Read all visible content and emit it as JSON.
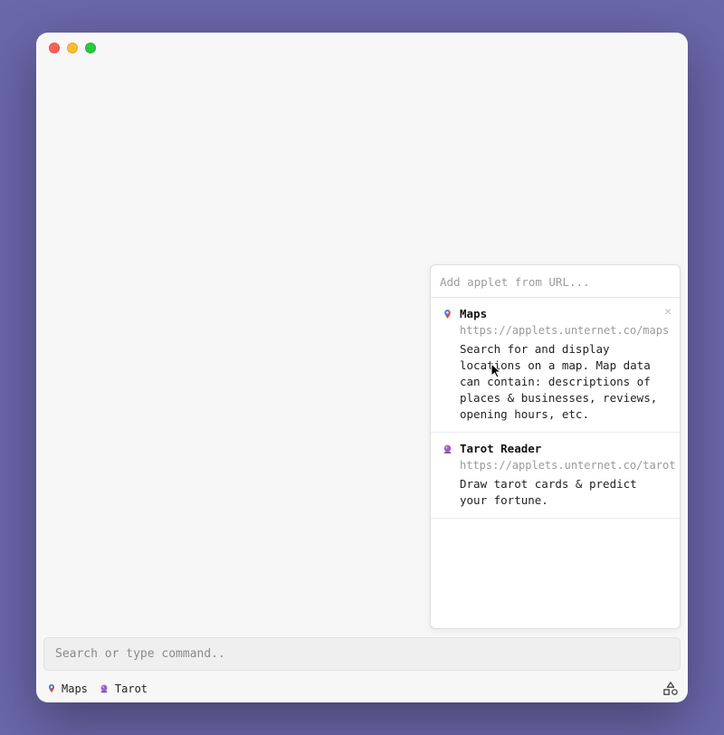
{
  "window": {
    "traffic": [
      "close",
      "minimize",
      "zoom"
    ]
  },
  "popover": {
    "url_input_placeholder": "Add applet from URL...",
    "applets": [
      {
        "icon": "maps-pin-icon",
        "name": "Maps",
        "url": "https://applets.unternet.co/maps",
        "description": "Search for and display locations on a map. Map data can contain: descriptions of places & businesses, reviews, opening hours, etc.",
        "closeable": true
      },
      {
        "icon": "crystal-ball-icon",
        "name": "Tarot Reader",
        "url": "https://applets.unternet.co/tarot",
        "description": "Draw tarot cards & predict your fortune.",
        "closeable": false
      }
    ]
  },
  "searchbar": {
    "placeholder": "Search or type command.."
  },
  "footer": {
    "items": [
      {
        "icon": "maps-pin-icon",
        "label": "Maps"
      },
      {
        "icon": "crystal-ball-icon",
        "label": "Tarot"
      }
    ],
    "right_icon": "shapes-icon"
  }
}
